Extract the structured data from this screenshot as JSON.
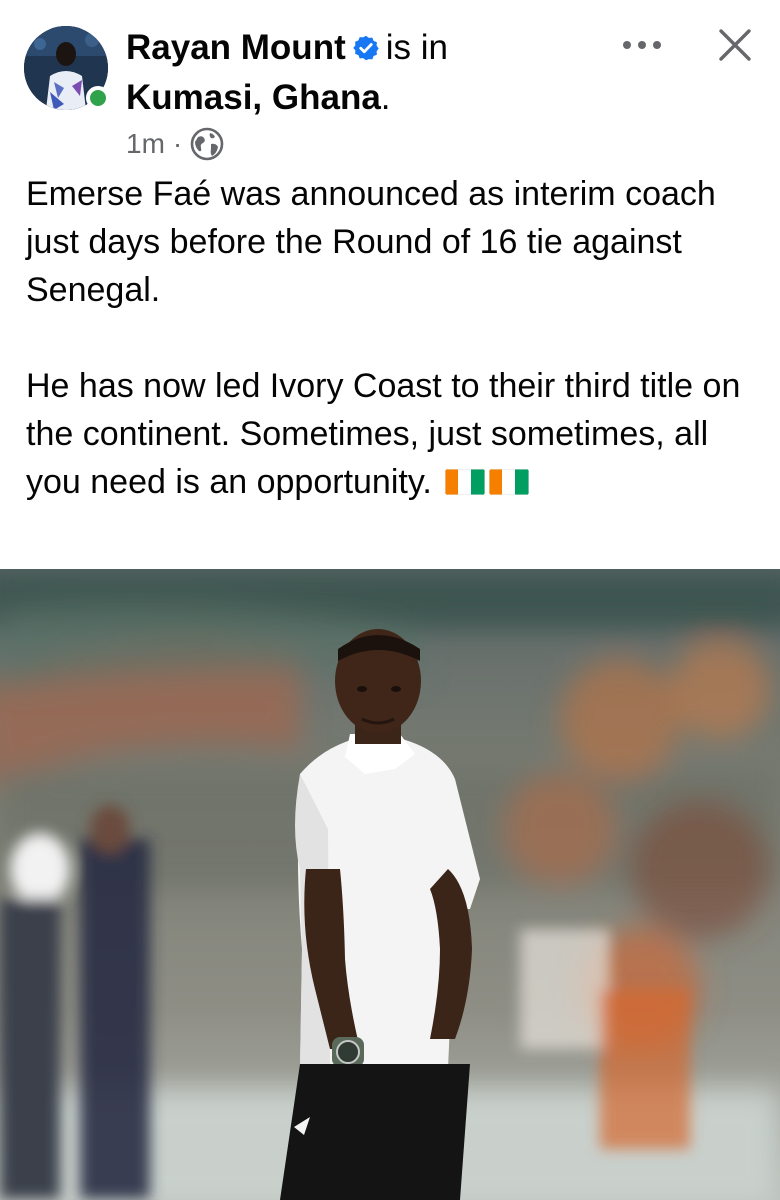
{
  "post": {
    "author": "Rayan Mount",
    "is_in": "is in",
    "location": "Kumasi, Ghana",
    "location_suffix": ".",
    "timestamp": "1m",
    "separator": "·",
    "audience_icon": "globe-icon",
    "verified_icon": "verified-badge-icon",
    "body": {
      "paragraph_1": "Emerse Faé was announced as interim coach just days before the Round of 16 tie against Senegal.",
      "paragraph_2": "He has now led Ivory Coast to their third title on the continent. Sometimes, just sometimes, all you need is an opportunity."
    },
    "flag_emoji_count": 2,
    "photo_subject": "man in white polo shirt and black shorts standing on a football pitch"
  },
  "controls": {
    "more_icon": "more-options-icon",
    "close_icon": "close-icon"
  },
  "colors": {
    "verified_blue": "#1877f2",
    "online_green": "#31a24c",
    "meta_gray": "#65676b",
    "flag_orange": "#f77f00",
    "flag_green": "#009e60"
  }
}
